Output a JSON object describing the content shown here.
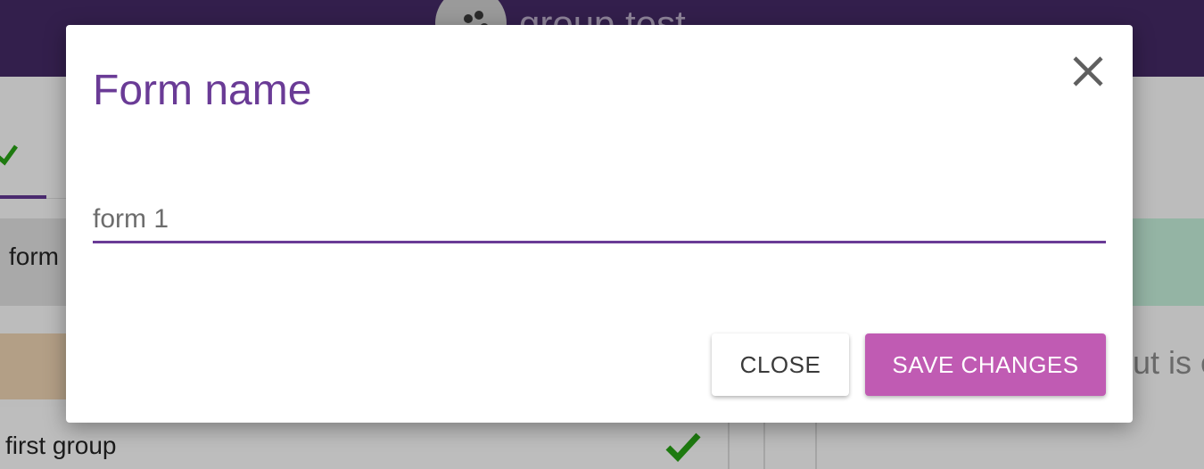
{
  "app": {
    "title": "group test",
    "logo_icon": "logo-icon"
  },
  "background": {
    "form_row_label": "form",
    "group_row_label": "first group",
    "right_panel_text": "ut is e",
    "check_icon": "check-icon"
  },
  "modal": {
    "title": "Form name",
    "close_icon": "close-icon",
    "input": {
      "value": "form 1",
      "placeholder": ""
    },
    "buttons": {
      "close_label": "CLOSE",
      "save_label": "SAVE CHANGES"
    }
  },
  "colors": {
    "accent": "#6a3b96",
    "save_button": "#c05bb3",
    "topbar": "#331f4c",
    "check_green": "#1e7a10"
  }
}
